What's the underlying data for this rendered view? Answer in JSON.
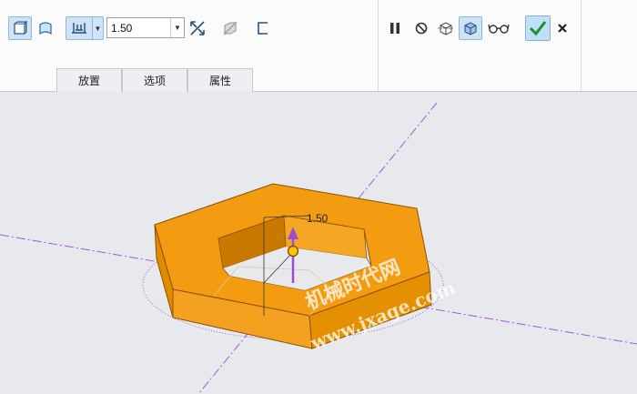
{
  "toolbar": {
    "thickness_value": "1.50",
    "buttons": {
      "solid": "solid-icon",
      "surface": "surface-icon",
      "depth_type": "blind-depth-icon",
      "flip": "flip-direction-icon",
      "remove_material": "remove-material-icon",
      "thicken": "thicken-sketch-icon",
      "pause": "pause-icon",
      "no_preview": "no-preview-icon",
      "preview_mesh": "preview-mesh-icon",
      "preview_verify": "verify-preview-icon",
      "glasses": "glasses-icon",
      "ok": "check-icon",
      "cancel": "close-icon"
    }
  },
  "tabs": [
    "放置",
    "选项",
    "属性"
  ],
  "viewport": {
    "dimension_label": "1.50",
    "watermark_cn": "机械时代网",
    "watermark_en": "www.jxage.com",
    "part_color": "#f39c12",
    "axis_color": "#a259d9"
  }
}
